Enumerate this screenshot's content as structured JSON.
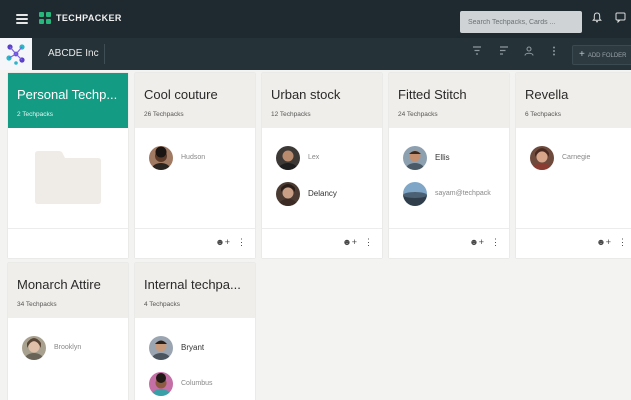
{
  "header": {
    "brand": "TECHPACKER",
    "search_placeholder": "Search Techpacks, Cards ..."
  },
  "subheader": {
    "org_name": "ABCDE Inc",
    "add_folder_label": "ADD FOLDER"
  },
  "folders": [
    {
      "title": "Personal Techp...",
      "count": "2 Techpacks",
      "active": true,
      "members": []
    },
    {
      "title": "Cool couture",
      "count": "26 Techpacks",
      "members": [
        {
          "name": "Hudson"
        }
      ]
    },
    {
      "title": "Urban stock",
      "count": "12 Techpacks",
      "members": [
        {
          "name": "Lex"
        },
        {
          "name": "Delancy"
        }
      ]
    },
    {
      "title": "Fitted Stitch",
      "count": "24 Techpacks",
      "members": [
        {
          "name": "Ellis"
        },
        {
          "name": "sayam@techpack"
        }
      ]
    },
    {
      "title": "Revella",
      "count": "6 Techpacks",
      "members": [
        {
          "name": "Carnegie"
        }
      ]
    },
    {
      "title": "Monarch Attire",
      "count": "34 Techpacks",
      "members": [
        {
          "name": "Brooklyn"
        }
      ]
    },
    {
      "title": "Internal techpa...",
      "count": "4 Techpacks",
      "members": [
        {
          "name": "Bryant"
        },
        {
          "name": "Columbus"
        }
      ]
    }
  ],
  "colors": {
    "accent": "#139b83",
    "topbar": "#1e2a30",
    "subbar": "#253238"
  },
  "icons": [
    "menu-icon",
    "bell-icon",
    "chat-icon",
    "filter-icon",
    "sort-icon",
    "person-icon",
    "more-vert-icon",
    "add-person-icon",
    "folder-icon"
  ]
}
